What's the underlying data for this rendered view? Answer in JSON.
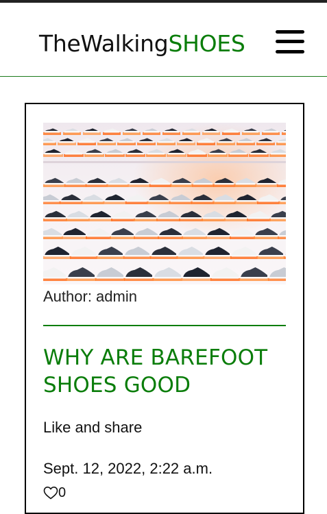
{
  "header": {
    "brand_prefix": "TheWalking",
    "brand_accent": "SHOES",
    "menu_icon": "hamburger-menu-icon",
    "accent_color": "#0a7d0a"
  },
  "post": {
    "image_alt": "Sneakers displayed on store shelves",
    "author_text": "Author: admin",
    "title": "WHY ARE BAREFOOT SHOES GOOD",
    "summary": "Like and share",
    "date": "Sept. 12, 2022, 2:22 a.m.",
    "like_icon": "heart-outline-icon",
    "like_count": "0"
  }
}
